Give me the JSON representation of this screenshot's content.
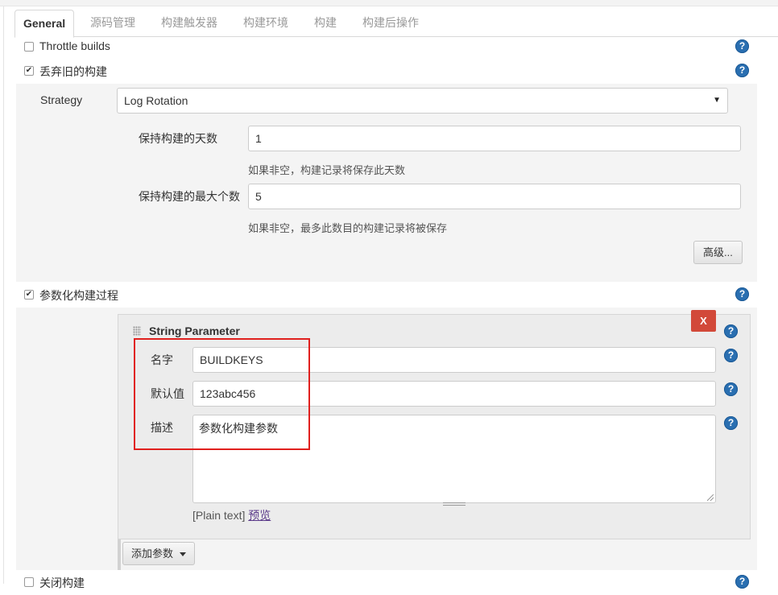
{
  "tabs": [
    {
      "label": "General",
      "active": true
    },
    {
      "label": "源码管理"
    },
    {
      "label": "构建触发器"
    },
    {
      "label": "构建环境"
    },
    {
      "label": "构建"
    },
    {
      "label": "构建后操作"
    }
  ],
  "options": {
    "throttle": {
      "label": "Throttle builds",
      "checked": false
    },
    "discard": {
      "label": "丢弃旧的构建",
      "checked": true
    },
    "parameterized": {
      "label": "参数化构建过程",
      "checked": true
    },
    "disable": {
      "label": "关闭构建",
      "checked": false
    }
  },
  "discard_settings": {
    "strategy_label": "Strategy",
    "strategy_value": "Log Rotation",
    "days_label": "保持构建的天数",
    "days_value": "1",
    "days_hint": "如果非空，构建记录将保存此天数",
    "max_label": "保持构建的最大个数",
    "max_value": "5",
    "max_hint": "如果非空，最多此数目的构建记录将被保存",
    "advanced_button": "高级..."
  },
  "string_parameter": {
    "title": "String Parameter",
    "delete_button": "X",
    "name_label": "名字",
    "name_value": "BUILDKEYS",
    "default_label": "默认值",
    "default_value": "123abc456",
    "desc_label": "描述",
    "desc_value": "参数化构建参数",
    "plain_text": "[Plain text]",
    "preview_link": "预览"
  },
  "add_param_button": "添加参数",
  "icons": {
    "help": "help-icon",
    "checkmark": "✔",
    "help_glyph": "?"
  },
  "colors": {
    "help_blue": "#2a6fb1",
    "delete_red": "#d24939",
    "highlight_red": "#e0201e"
  }
}
